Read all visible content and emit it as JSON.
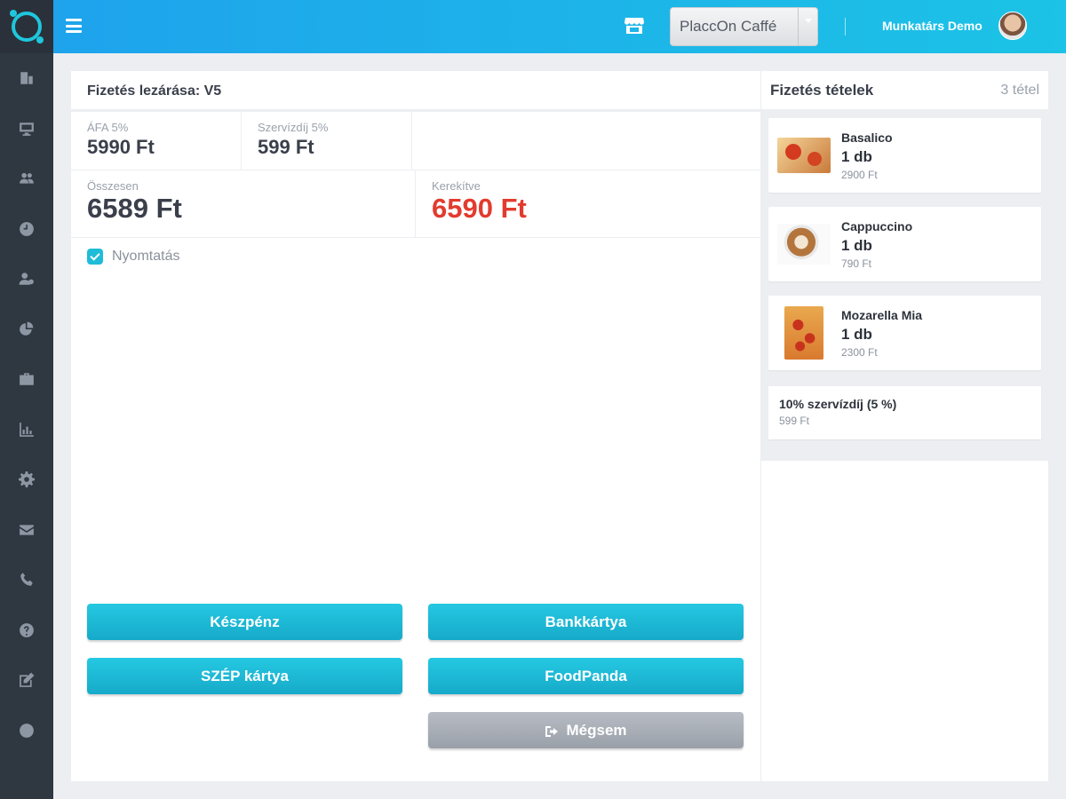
{
  "topbar": {
    "store": "PlaccOn Caffé",
    "user": "Munkatárs Demo",
    "icons": {
      "menu": "hamburger-icon",
      "store": "store-icon"
    }
  },
  "sidebar": {
    "icons": [
      "building-icon",
      "monitor-icon",
      "users-icon",
      "clock-icon",
      "user-group-icon",
      "pie-icon",
      "briefcase-icon",
      "chart-icon",
      "gear-icon",
      "mail-icon",
      "phone-icon",
      "help-icon",
      "edit-icon",
      "globe-icon"
    ]
  },
  "main": {
    "title": "Fizetés lezárása: V5",
    "stats": {
      "vat_label": "ÁFA 5%",
      "vat_value": "5990 Ft",
      "service_label": "Szervízdíj 5%",
      "service_value": "599 Ft",
      "total_label": "Összesen",
      "total_value": "6589 Ft",
      "rounded_label": "Kerekítve",
      "rounded_value": "6590 Ft"
    },
    "print_label": "Nyomtatás",
    "print_checked": true,
    "buttons": {
      "cash": "Készpénz",
      "bankcard": "Bankkártya",
      "szep": "SZÉP kártya",
      "foodpanda": "FoodPanda",
      "cancel": "Mégsem"
    }
  },
  "side": {
    "title": "Fizetés tételek",
    "count": "3 tétel",
    "items": [
      {
        "name": "Basalico",
        "qty": "1 db",
        "price": "2900 Ft"
      },
      {
        "name": "Cappuccino",
        "qty": "1 db",
        "price": "790 Ft"
      },
      {
        "name": "Mozarella Mia",
        "qty": "1 db",
        "price": "2300 Ft"
      }
    ],
    "fee": {
      "name": "10% szervízdíj (5 %)",
      "price": "599 Ft"
    }
  },
  "colors": {
    "accent": "#1fbcd8",
    "sidebar": "#2f3741",
    "danger": "#e23b2e"
  }
}
